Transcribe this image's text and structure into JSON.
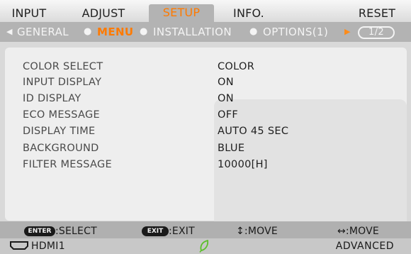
{
  "tabs": [
    {
      "label": "INPUT",
      "active": false
    },
    {
      "label": "ADJUST",
      "active": false
    },
    {
      "label": "SETUP",
      "active": true
    },
    {
      "label": "INFO.",
      "active": false
    },
    {
      "label": "RESET",
      "active": false
    }
  ],
  "subtabs": [
    {
      "label": "GENERAL",
      "active": false
    },
    {
      "label": "MENU",
      "active": true
    },
    {
      "label": "INSTALLATION",
      "active": false
    },
    {
      "label": "OPTIONS(1)",
      "active": false
    }
  ],
  "page_indicator": "1/2",
  "settings": [
    {
      "label": "COLOR SELECT",
      "value": "COLOR"
    },
    {
      "label": "INPUT DISPLAY",
      "value": "ON"
    },
    {
      "label": "ID DISPLAY",
      "value": "ON"
    },
    {
      "label": "ECO MESSAGE",
      "value": "OFF"
    },
    {
      "label": "DISPLAY TIME",
      "value": "AUTO 45 SEC"
    },
    {
      "label": "BACKGROUND",
      "value": "BLUE"
    },
    {
      "label": "FILTER MESSAGE",
      "value": "10000[H]"
    }
  ],
  "help": {
    "enter_key": "ENTER",
    "enter_text": ":SELECT",
    "exit_key": "EXIT",
    "exit_text": ":EXIT",
    "updown_text": "↕:MOVE",
    "leftright_text": "↔:MOVE"
  },
  "status": {
    "source": "HDMI1",
    "mode": "ADVANCED"
  },
  "colors": {
    "accent": "#ff7a00",
    "eco_leaf": "#5cbf2a"
  },
  "icons": {
    "source": "hdmi-connector-icon",
    "eco": "eco-leaf-icon",
    "scroll_left": "triangle-left-icon",
    "scroll_right": "triangle-right-icon"
  }
}
